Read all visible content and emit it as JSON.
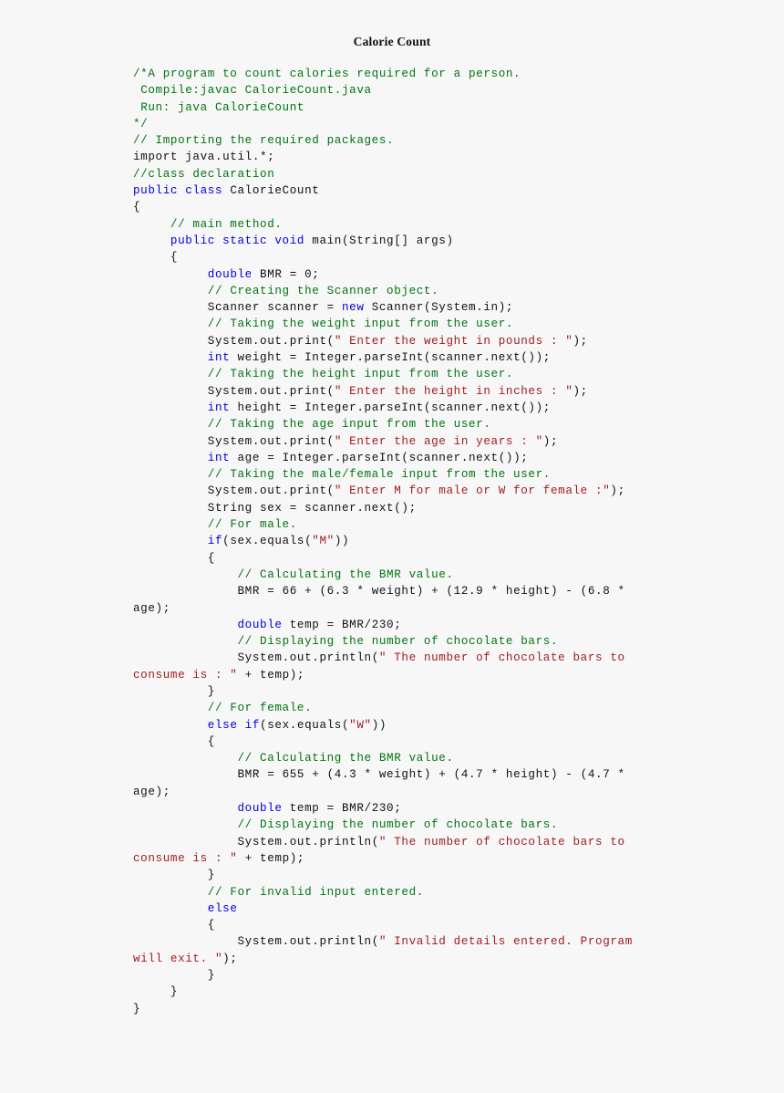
{
  "document": {
    "title": "Calorie Count",
    "language": "java",
    "filename": "CalorieCount.java"
  },
  "theme": {
    "background": "#f7f7f7",
    "plain": "#111111",
    "comment": "#007410",
    "keyword": "#0000dd",
    "string": "#9e1b1b"
  },
  "code": {
    "lines": [
      {
        "n": 1,
        "tokens": [
          {
            "t": "cm",
            "s": "/*A program to count calories required for a person."
          }
        ]
      },
      {
        "n": 2,
        "tokens": [
          {
            "t": "cm",
            "s": " Compile:javac CalorieCount.java"
          }
        ]
      },
      {
        "n": 3,
        "tokens": [
          {
            "t": "cm",
            "s": " Run: java CalorieCount"
          }
        ]
      },
      {
        "n": 4,
        "tokens": [
          {
            "t": "cm",
            "s": "*/"
          }
        ]
      },
      {
        "n": 5,
        "tokens": [
          {
            "t": "cm",
            "s": "// Importing the required packages."
          }
        ]
      },
      {
        "n": 6,
        "tokens": [
          {
            "t": "pl",
            "s": "import java.util.*;"
          }
        ]
      },
      {
        "n": 7,
        "tokens": [
          {
            "t": "cm",
            "s": "//class declaration"
          }
        ]
      },
      {
        "n": 8,
        "tokens": [
          {
            "t": "kw",
            "s": "public class "
          },
          {
            "t": "pl",
            "s": "CalorieCount"
          }
        ]
      },
      {
        "n": 9,
        "tokens": [
          {
            "t": "pl",
            "s": "{"
          }
        ]
      },
      {
        "n": 10,
        "tokens": [
          {
            "t": "cm",
            "s": "     // main method."
          }
        ]
      },
      {
        "n": 11,
        "tokens": [
          {
            "t": "kw",
            "s": "     public static void "
          },
          {
            "t": "pl",
            "s": "main(String[] args)"
          }
        ]
      },
      {
        "n": 12,
        "tokens": [
          {
            "t": "pl",
            "s": "     {"
          }
        ]
      },
      {
        "n": 13,
        "tokens": [
          {
            "t": "kw",
            "s": "          double "
          },
          {
            "t": "pl",
            "s": "BMR = 0;"
          }
        ]
      },
      {
        "n": 14,
        "tokens": [
          {
            "t": "cm",
            "s": "          // Creating the Scanner object."
          }
        ]
      },
      {
        "n": 15,
        "tokens": [
          {
            "t": "pl",
            "s": "          Scanner scanner = "
          },
          {
            "t": "kw",
            "s": "new "
          },
          {
            "t": "pl",
            "s": "Scanner(System.in);"
          }
        ]
      },
      {
        "n": 16,
        "tokens": [
          {
            "t": "cm",
            "s": "          // Taking the weight input from the user."
          }
        ]
      },
      {
        "n": 17,
        "tokens": [
          {
            "t": "pl",
            "s": "          System.out.print("
          },
          {
            "t": "str",
            "s": "\" Enter the weight in pounds : \""
          },
          {
            "t": "pl",
            "s": ");"
          }
        ]
      },
      {
        "n": 18,
        "tokens": [
          {
            "t": "kw",
            "s": "          int "
          },
          {
            "t": "pl",
            "s": "weight = Integer.parseInt(scanner.next());"
          }
        ]
      },
      {
        "n": 19,
        "tokens": [
          {
            "t": "cm",
            "s": "          // Taking the height input from the user."
          }
        ]
      },
      {
        "n": 20,
        "tokens": [
          {
            "t": "pl",
            "s": "          System.out.print("
          },
          {
            "t": "str",
            "s": "\" Enter the height in inches : \""
          },
          {
            "t": "pl",
            "s": ");"
          }
        ]
      },
      {
        "n": 21,
        "tokens": [
          {
            "t": "kw",
            "s": "          int "
          },
          {
            "t": "pl",
            "s": "height = Integer.parseInt(scanner.next());"
          }
        ]
      },
      {
        "n": 22,
        "tokens": [
          {
            "t": "cm",
            "s": "          // Taking the age input from the user."
          }
        ]
      },
      {
        "n": 23,
        "tokens": [
          {
            "t": "pl",
            "s": "          System.out.print("
          },
          {
            "t": "str",
            "s": "\" Enter the age in years : \""
          },
          {
            "t": "pl",
            "s": ");"
          }
        ]
      },
      {
        "n": 24,
        "tokens": [
          {
            "t": "kw",
            "s": "          int "
          },
          {
            "t": "pl",
            "s": "age = Integer.parseInt(scanner.next());"
          }
        ]
      },
      {
        "n": 25,
        "tokens": [
          {
            "t": "cm",
            "s": "          // Taking the male/female input from the user."
          }
        ]
      },
      {
        "n": 26,
        "tokens": [
          {
            "t": "pl",
            "s": "          System.out.print("
          },
          {
            "t": "str",
            "s": "\" Enter M for male or W for female :\""
          },
          {
            "t": "pl",
            "s": ");"
          }
        ]
      },
      {
        "n": 27,
        "tokens": [
          {
            "t": "pl",
            "s": "          String sex = scanner.next();"
          }
        ]
      },
      {
        "n": 28,
        "tokens": [
          {
            "t": "cm",
            "s": "          // For male."
          }
        ]
      },
      {
        "n": 29,
        "tokens": [
          {
            "t": "kw",
            "s": "          if"
          },
          {
            "t": "pl",
            "s": "(sex.equals("
          },
          {
            "t": "str",
            "s": "\"M\""
          },
          {
            "t": "pl",
            "s": "))"
          }
        ]
      },
      {
        "n": 30,
        "tokens": [
          {
            "t": "pl",
            "s": "          {"
          }
        ]
      },
      {
        "n": 31,
        "tokens": [
          {
            "t": "cm",
            "s": "              // Calculating the BMR value."
          }
        ]
      },
      {
        "n": 32,
        "tokens": [
          {
            "t": "pl",
            "s": "              BMR = 66 + (6.3 * weight) + (12.9 * height) - (6.8 * age);"
          }
        ]
      },
      {
        "n": 33,
        "tokens": [
          {
            "t": "kw",
            "s": "              double "
          },
          {
            "t": "pl",
            "s": "temp = BMR/230;"
          }
        ]
      },
      {
        "n": 34,
        "tokens": [
          {
            "t": "cm",
            "s": "              // Displaying the number of chocolate bars."
          }
        ]
      },
      {
        "n": 35,
        "tokens": [
          {
            "t": "pl",
            "s": "              System.out.println("
          },
          {
            "t": "str",
            "s": "\" The number of chocolate bars to consume is : \""
          },
          {
            "t": "pl",
            "s": " + temp);"
          }
        ]
      },
      {
        "n": 36,
        "tokens": [
          {
            "t": "pl",
            "s": "          }"
          }
        ]
      },
      {
        "n": 37,
        "tokens": [
          {
            "t": "cm",
            "s": "          // For female."
          }
        ]
      },
      {
        "n": 38,
        "tokens": [
          {
            "t": "kw",
            "s": "          else if"
          },
          {
            "t": "pl",
            "s": "(sex.equals("
          },
          {
            "t": "str",
            "s": "\"W\""
          },
          {
            "t": "pl",
            "s": "))"
          }
        ]
      },
      {
        "n": 39,
        "tokens": [
          {
            "t": "pl",
            "s": "          {"
          }
        ]
      },
      {
        "n": 40,
        "tokens": [
          {
            "t": "cm",
            "s": "              // Calculating the BMR value."
          }
        ]
      },
      {
        "n": 41,
        "tokens": [
          {
            "t": "pl",
            "s": "              BMR = 655 + (4.3 * weight) + (4.7 * height) - (4.7 * age);"
          }
        ]
      },
      {
        "n": 42,
        "tokens": [
          {
            "t": "kw",
            "s": "              double "
          },
          {
            "t": "pl",
            "s": "temp = BMR/230;"
          }
        ]
      },
      {
        "n": 43,
        "tokens": [
          {
            "t": "cm",
            "s": "              // Displaying the number of chocolate bars."
          }
        ]
      },
      {
        "n": 44,
        "tokens": [
          {
            "t": "pl",
            "s": "              System.out.println("
          },
          {
            "t": "str",
            "s": "\" The number of chocolate bars to consume is : \""
          },
          {
            "t": "pl",
            "s": " + temp);"
          }
        ]
      },
      {
        "n": 45,
        "tokens": [
          {
            "t": "pl",
            "s": "          }"
          }
        ]
      },
      {
        "n": 46,
        "tokens": [
          {
            "t": "cm",
            "s": "          // For invalid input entered."
          }
        ]
      },
      {
        "n": 47,
        "tokens": [
          {
            "t": "kw",
            "s": "          else"
          }
        ]
      },
      {
        "n": 48,
        "tokens": [
          {
            "t": "pl",
            "s": "          {"
          }
        ]
      },
      {
        "n": 49,
        "tokens": [
          {
            "t": "pl",
            "s": "              System.out.println("
          },
          {
            "t": "str",
            "s": "\" Invalid details entered. Program will exit. \""
          },
          {
            "t": "pl",
            "s": ");"
          }
        ]
      },
      {
        "n": 50,
        "tokens": [
          {
            "t": "pl",
            "s": "          }"
          }
        ]
      },
      {
        "n": 51,
        "tokens": [
          {
            "t": "pl",
            "s": "     }"
          }
        ]
      },
      {
        "n": 52,
        "tokens": [
          {
            "t": "pl",
            "s": "}"
          }
        ]
      }
    ]
  }
}
